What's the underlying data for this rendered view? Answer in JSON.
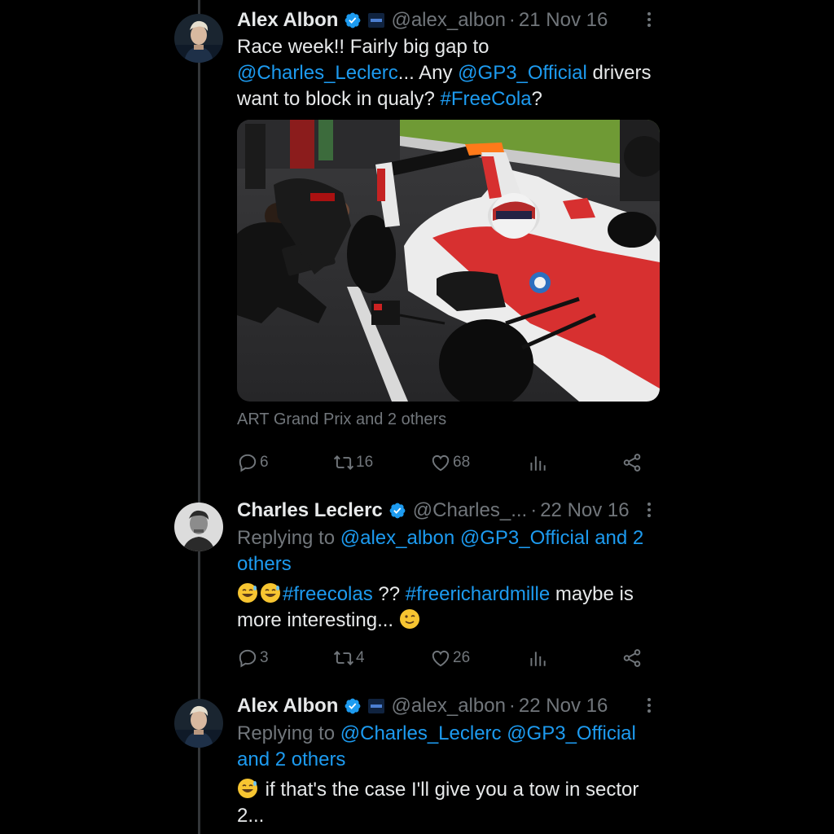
{
  "tweets": [
    {
      "name": "Alex Albon",
      "handle": "@alex_albon",
      "dot": "·",
      "date": "21 Nov 16",
      "text": {
        "t1": "Race week!! Fairly big gap to ",
        "m1": "@Charles_Leclerc",
        "t2": "... Any ",
        "m2": "@GP3_Official",
        "t3": " drivers want to block in qualy? ",
        "h1": "#FreeCola",
        "t4": "?"
      },
      "tagged": "ART Grand Prix and 2 others",
      "replies": "6",
      "reposts": "16",
      "likes": "68"
    },
    {
      "name": "Charles Leclerc",
      "handle": "@Charles_...",
      "dot": "·",
      "date": "22 Nov 16",
      "replying_prefix": "Replying to ",
      "replying_to": "@alex_albon @GP3_Official and 2 others",
      "text": {
        "h1": "#freecolas",
        "t1": " ?? ",
        "h2": "#freerichardmille",
        "t2": " maybe is more interesting... "
      },
      "replies": "3",
      "reposts": "4",
      "likes": "26"
    },
    {
      "name": "Alex Albon",
      "handle": "@alex_albon",
      "dot": "·",
      "date": "22 Nov 16",
      "replying_prefix": "Replying to ",
      "replying_to": "@Charles_Leclerc @GP3_Official and 2 others",
      "text": {
        "t1": " if that's the case I'll give you a tow in sector 2..."
      }
    }
  ],
  "icons": {
    "verified": "verified-badge-icon",
    "affiliate": "affiliate-badge-icon",
    "reply": "reply-icon",
    "repost": "repost-icon",
    "like": "heart-icon",
    "views": "views-chart-icon",
    "share": "share-icon",
    "more": "more-dots-icon"
  },
  "colors": {
    "background": "#000000",
    "text": "#e7e9ea",
    "muted": "#71767b",
    "link": "#1d9bf0",
    "thread_line": "#333639"
  }
}
